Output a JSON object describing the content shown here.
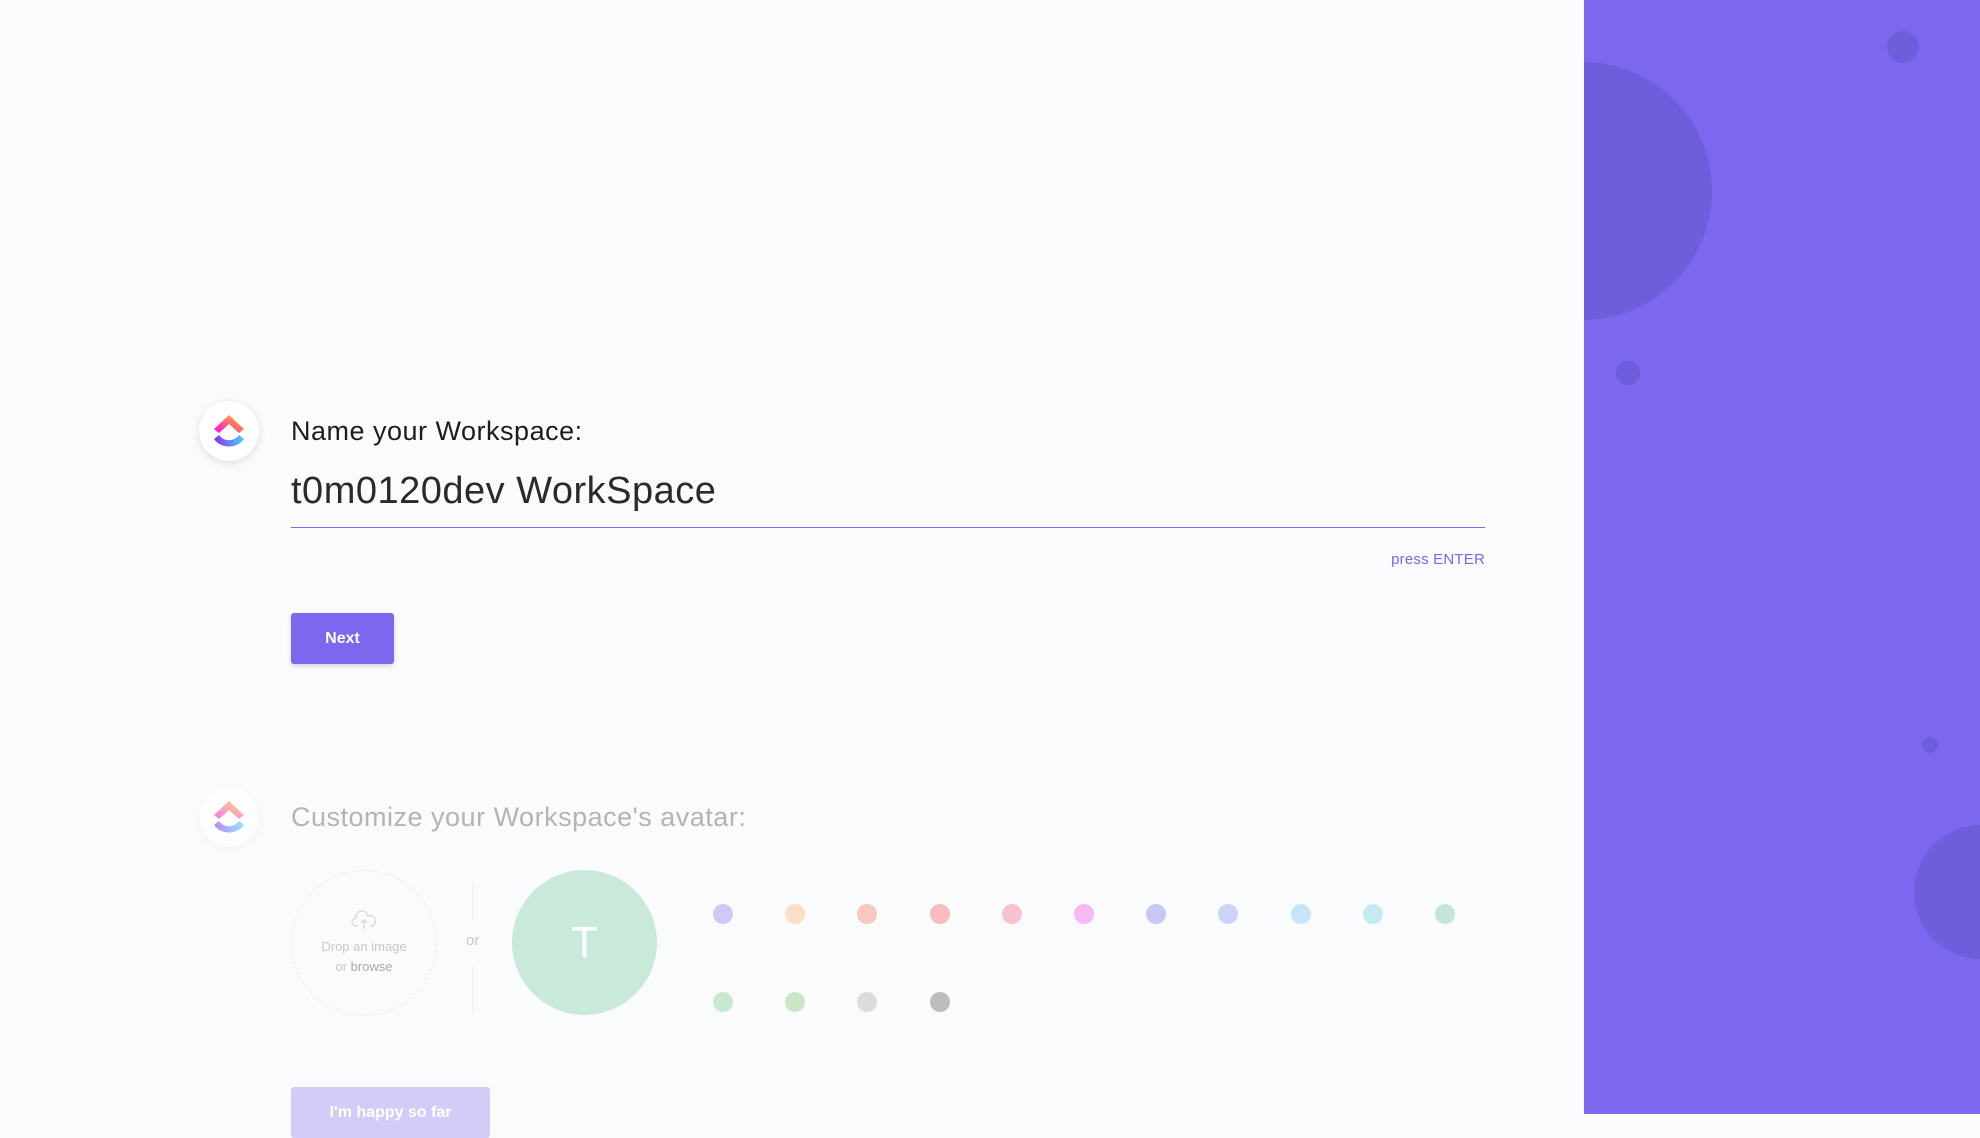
{
  "step1": {
    "title": "Name your Workspace:",
    "input_value": "t0m0120dev WorkSpace",
    "hint": "press ENTER",
    "next_label": "Next"
  },
  "step2": {
    "title": "Customize your Workspace's avatar:",
    "drop_text": "Drop an image",
    "drop_or": "or",
    "browse_label": "browse",
    "or_separator": "or",
    "avatar_letter": "T",
    "avatar_color": "#c9e9da",
    "colors_row1": [
      "#cfc9f7",
      "#fbe0c5",
      "#f9c7bd",
      "#f8bcbd",
      "#f8c1ce",
      "#f7b9f4",
      "#c6c8f5",
      "#c9d4f8",
      "#c5e5f8",
      "#c3ebf1",
      "#c5e5da"
    ],
    "colors_row2": [
      "#c7e9cf",
      "#c9e7c6",
      "#dcdcde",
      "#bdbdbf"
    ],
    "happy_label": "I'm happy so far"
  },
  "theme": {
    "accent": "#7b68ee"
  },
  "icons": {
    "logo": "clickup-logo-icon",
    "upload": "cloud-upload-icon"
  }
}
